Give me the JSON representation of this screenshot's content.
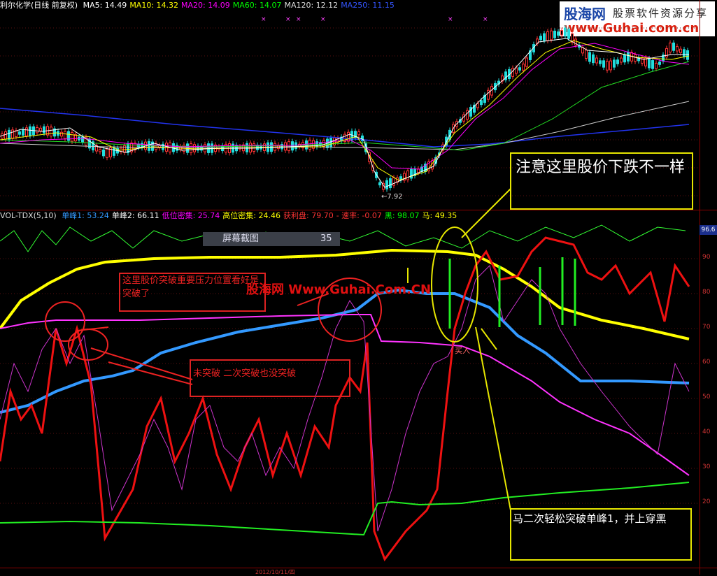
{
  "header": {
    "stock": "利尔化学(日线 前复权)",
    "ma": [
      {
        "label": "MA5: 14.49",
        "color": "#ffffff"
      },
      {
        "label": "MA10: 14.32",
        "color": "#ffff00"
      },
      {
        "label": "MA20: 14.09",
        "color": "#ff00ff"
      },
      {
        "label": "MA60: 14.07",
        "color": "#00ff00"
      },
      {
        "label": "MA120: 12.12",
        "color": "#dddddd"
      },
      {
        "label": "MA250: 11.15",
        "color": "#3355ff"
      }
    ]
  },
  "indicator": {
    "name": "VOL-TDX(5,10)",
    "items": [
      {
        "label": "单峰1: 53.24",
        "color": "#3399ff"
      },
      {
        "label": "单峰2: 66.11",
        "color": "#ffffff"
      },
      {
        "label": "低位密集: 25.74",
        "color": "#ff00ff"
      },
      {
        "label": "高位密集: 24.46",
        "color": "#ffff00"
      },
      {
        "label": "获利盘: 79.70",
        "color": "#ff3333"
      },
      {
        "label": "- 速率: -0.07",
        "color": "#ff3333"
      },
      {
        "label": "黑: 98.07",
        "color": "#00ff00"
      },
      {
        "label": "马: 49.35",
        "color": "#ffff00"
      }
    ],
    "right_value": "96.6"
  },
  "price_marker": "←7.92",
  "screenshot_bar": {
    "title": "屏幕截图",
    "number": "35"
  },
  "logo": {
    "a": "股海网",
    "b": "股票软件资源分享",
    "c": "www.Guhai.com.cn"
  },
  "watermark": "股海网 Www.Guhai.Com.CN",
  "annotations": {
    "note1": "这里股价突破重要压力位置看好是突破了",
    "note2": "未突破 二次突破也没突破",
    "note3": "注意这里股价下跌不一样",
    "note4": "马二次轻松突破单峰1，并上穿黑",
    "buy_label": "买入"
  },
  "bottom_axis": "2012/10/11/四",
  "right_ticks": [
    "90",
    "80",
    "70",
    "60",
    "50",
    "40",
    "30",
    "20"
  ],
  "colors": {
    "axis": "#8b0000",
    "yellow": "#e6e600",
    "red_annot": "#dd2222"
  }
}
